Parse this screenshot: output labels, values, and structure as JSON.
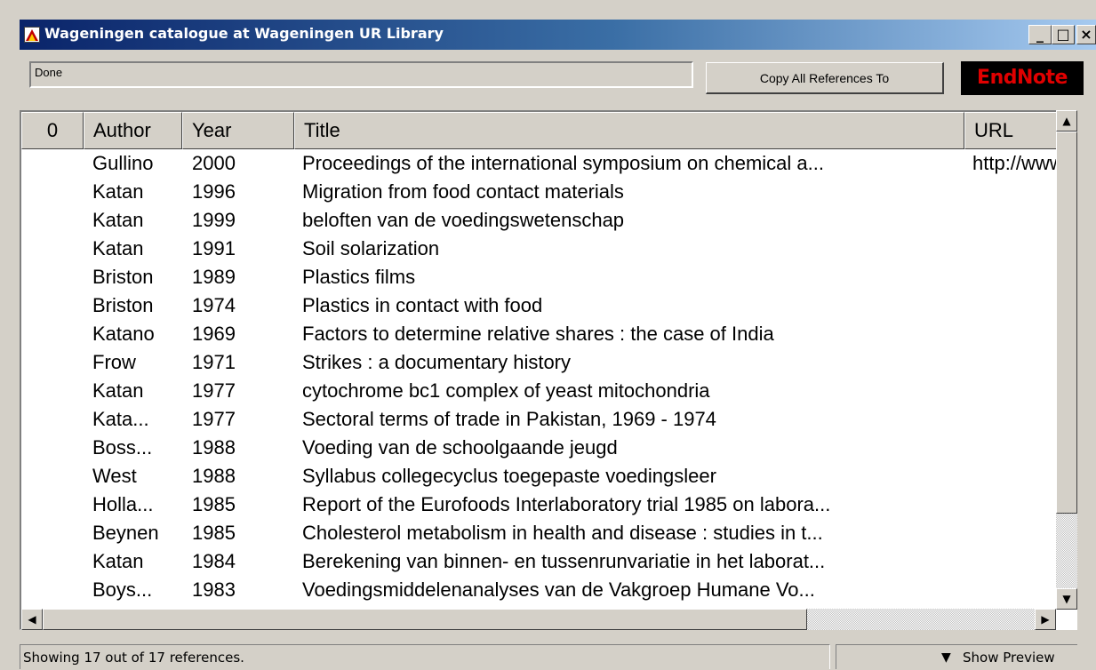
{
  "window": {
    "title": "Wageningen catalogue at Wageningen UR Library",
    "controls": {
      "minimize": "_",
      "maximize": "□",
      "close": "×"
    }
  },
  "toolbar": {
    "status_text": "Done",
    "copy_button_label": "Copy All References To",
    "logo_text": "EndNote"
  },
  "table": {
    "columns": {
      "attachment": "0",
      "author": "Author",
      "year": "Year",
      "title": "Title",
      "url": "URL"
    },
    "rows": [
      {
        "author": "Gullino",
        "year": "2000",
        "title": "Proceedings of the international symposium on chemical a...",
        "url": "http://www"
      },
      {
        "author": "Katan",
        "year": "1996",
        "title": "Migration from food contact materials",
        "url": ""
      },
      {
        "author": "Katan",
        "year": "1999",
        "title": "beloften van de voedingswetenschap",
        "url": ""
      },
      {
        "author": "Katan",
        "year": "1991",
        "title": "Soil solarization",
        "url": ""
      },
      {
        "author": "Briston",
        "year": "1989",
        "title": "Plastics films",
        "url": ""
      },
      {
        "author": "Briston",
        "year": "1974",
        "title": "Plastics in contact with food",
        "url": ""
      },
      {
        "author": "Katano",
        "year": "1969",
        "title": "Factors to determine relative shares : the case of India",
        "url": ""
      },
      {
        "author": "Frow",
        "year": "1971",
        "title": "Strikes : a documentary history",
        "url": ""
      },
      {
        "author": "Katan",
        "year": "1977",
        "title": "cytochrome bc1 complex of yeast mitochondria",
        "url": ""
      },
      {
        "author": "Kata...",
        "year": "1977",
        "title": "Sectoral terms of trade in Pakistan, 1969 - 1974",
        "url": ""
      },
      {
        "author": "Boss...",
        "year": "1988",
        "title": "Voeding van de schoolgaande jeugd",
        "url": ""
      },
      {
        "author": "West",
        "year": "1988",
        "title": "Syllabus collegecyclus toegepaste voedingsleer",
        "url": ""
      },
      {
        "author": "Holla...",
        "year": "1985",
        "title": "Report of the Eurofoods Interlaboratory trial 1985 on labora...",
        "url": ""
      },
      {
        "author": "Beynen",
        "year": "1985",
        "title": "Cholesterol metabolism in health and disease : studies in t...",
        "url": ""
      },
      {
        "author": "Katan",
        "year": "1984",
        "title": "Berekening van binnen- en tussenrunvariatie in het laborat...",
        "url": ""
      },
      {
        "author": "Boys...",
        "year": "1983",
        "title": "Voedingsmiddelenanalyses van de Vakgroep Humane Vo...",
        "url": ""
      }
    ]
  },
  "statusbar": {
    "count_text": "Showing 17 out of 17 references.",
    "preview_label": "Show Preview",
    "preview_icon": "double-chevron-down-icon"
  },
  "colors": {
    "title_bar": "#0a246a",
    "logo_background": "#000000",
    "logo_text": "#e00000",
    "window_face": "#d4d0c8"
  }
}
